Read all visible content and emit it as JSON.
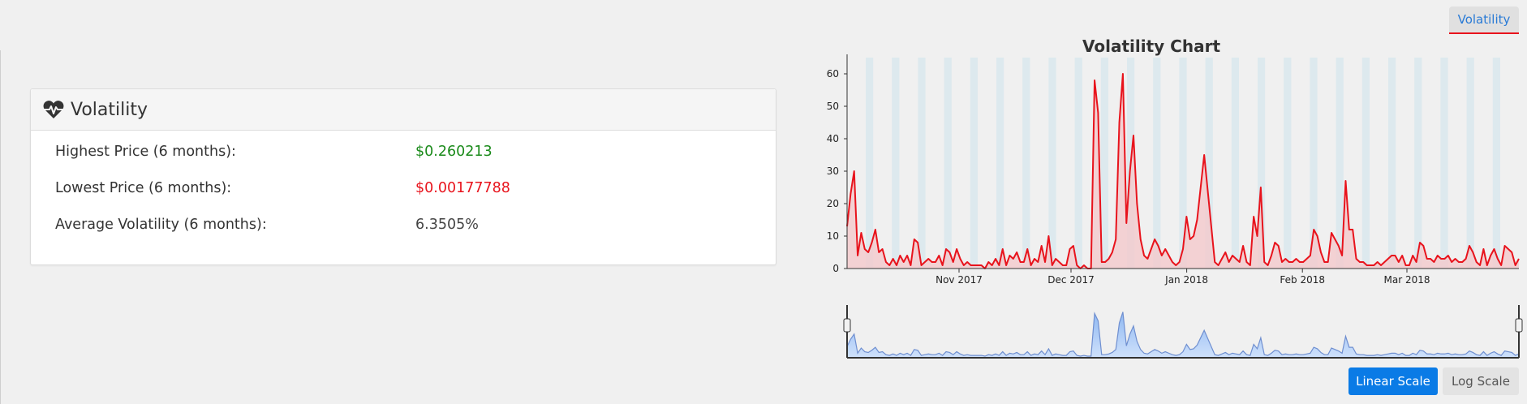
{
  "tabs": {
    "volatility_label": "Volatility"
  },
  "panel": {
    "title": "Volatility",
    "icon": "heartbeat-icon",
    "stats": [
      {
        "label": "Highest Price (6 months):",
        "value": "$0.260213",
        "color": "#1a8a1a"
      },
      {
        "label": "Lowest Price (6 months):",
        "value": "$0.00177788",
        "color": "#e8131c"
      },
      {
        "label": "Average Volatility (6 months):",
        "value": "6.3505%",
        "color": "#444444"
      }
    ]
  },
  "buttons": {
    "linear_scale": "Linear Scale",
    "log_scale": "Log Scale"
  },
  "chart_data": {
    "type": "area",
    "title": "Volatility Chart",
    "xlabel": "",
    "ylabel": "",
    "ylim": [
      0,
      65
    ],
    "yticks": [
      0,
      10,
      20,
      30,
      40,
      50,
      60
    ],
    "xticks": [
      {
        "label": "Nov 2017",
        "date": "2017-11-01"
      },
      {
        "label": "Dec 2017",
        "date": "2017-12-01"
      },
      {
        "label": "Jan 2018",
        "date": "2018-01-01"
      },
      {
        "label": "Feb 2018",
        "date": "2018-02-01"
      },
      {
        "label": "Mar 2018",
        "date": "2018-03-01"
      }
    ],
    "x_range": [
      "2017-10-02",
      "2018-03-31"
    ],
    "weekend_shading": true,
    "line_color": "#e8131c",
    "fill_color": "#f4c7c9",
    "navigator_color": "#6f8fd0",
    "series": [
      {
        "values": [
          13,
          23,
          30,
          4,
          11,
          6,
          5,
          8,
          12,
          5,
          6,
          2,
          1,
          3,
          1,
          4,
          2,
          4,
          1,
          9,
          8,
          1,
          2,
          3,
          2,
          2,
          4,
          1,
          6,
          5,
          2,
          6,
          3,
          1,
          2,
          1,
          1,
          1,
          1,
          0,
          2,
          1,
          3,
          1,
          6,
          1,
          4,
          3,
          5,
          2,
          2,
          6,
          1,
          3,
          2,
          7,
          2,
          10,
          1,
          3,
          2,
          1,
          1,
          6,
          7,
          1,
          0,
          1,
          0,
          0,
          58,
          48,
          2,
          2,
          3,
          5,
          9,
          45,
          60,
          14,
          30,
          41,
          20,
          9,
          4,
          3,
          6,
          9,
          7,
          4,
          6,
          4,
          2,
          1,
          2,
          6,
          16,
          9,
          10,
          15,
          25,
          35,
          24,
          13,
          2,
          1,
          3,
          5,
          2,
          4,
          3,
          2,
          7,
          2,
          1,
          16,
          10,
          25,
          2,
          1,
          4,
          8,
          7,
          2,
          3,
          2,
          2,
          3,
          2,
          2,
          3,
          4,
          12,
          10,
          5,
          2,
          2,
          11,
          9,
          7,
          4,
          27,
          12,
          12,
          3,
          2,
          2,
          1,
          1,
          1,
          2,
          1,
          2,
          3,
          4,
          4,
          2,
          4,
          1,
          1,
          4,
          2,
          8,
          7,
          3,
          3,
          2,
          4,
          3,
          3,
          4,
          2,
          3,
          2,
          2,
          3,
          7,
          5,
          2,
          1,
          6,
          1,
          4,
          6,
          3,
          1,
          7,
          6,
          5,
          1,
          3
        ]
      }
    ]
  }
}
